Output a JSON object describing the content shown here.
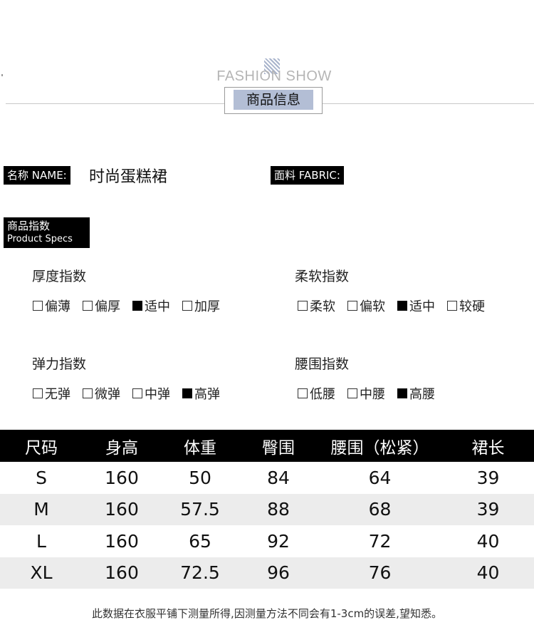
{
  "header": {
    "subtitle": "FASHION SHOW",
    "title": "商品信息"
  },
  "product": {
    "name_label": "名称 NAME:",
    "name_value": "时尚蛋糕裙",
    "fabric_label": "面料 FABRIC:",
    "fabric_value": ""
  },
  "specs": {
    "label_cn": "商品指数",
    "label_en": "Product Specs",
    "groups": [
      {
        "title": "厚度指数",
        "options": [
          {
            "label": "偏薄",
            "checked": false
          },
          {
            "label": "偏厚",
            "checked": false
          },
          {
            "label": "适中",
            "checked": true
          },
          {
            "label": "加厚",
            "checked": false
          }
        ]
      },
      {
        "title": "柔软指数",
        "options": [
          {
            "label": "柔软",
            "checked": false
          },
          {
            "label": "偏软",
            "checked": false
          },
          {
            "label": "适中",
            "checked": true
          },
          {
            "label": "较硬",
            "checked": false
          }
        ]
      },
      {
        "title": "弹力指数",
        "options": [
          {
            "label": "无弹",
            "checked": false
          },
          {
            "label": "微弹",
            "checked": false
          },
          {
            "label": "中弹",
            "checked": false
          },
          {
            "label": "高弹",
            "checked": true
          }
        ]
      },
      {
        "title": "腰围指数",
        "options": [
          {
            "label": "低腰",
            "checked": false
          },
          {
            "label": "中腰",
            "checked": false
          },
          {
            "label": "高腰",
            "checked": true
          }
        ]
      }
    ]
  },
  "size_table": {
    "headers": [
      "尺码",
      "身高",
      "体重",
      "臀围",
      "腰围（松紧）",
      "裙长"
    ],
    "rows": [
      [
        "S",
        "160",
        "50",
        "84",
        "64",
        "39"
      ],
      [
        "M",
        "160",
        "57.5",
        "88",
        "68",
        "39"
      ],
      [
        "L",
        "160",
        "65",
        "92",
        "72",
        "40"
      ],
      [
        "XL",
        "160",
        "72.5",
        "96",
        "76",
        "40"
      ]
    ]
  },
  "note": "此数据在衣服平铺下测量所得,因测量方法不同会有1-3cm的误差,望知悉。",
  "colors": {
    "accent_box": "#b3bed5",
    "table_header": "#000000",
    "row_alt": "#ececec"
  }
}
